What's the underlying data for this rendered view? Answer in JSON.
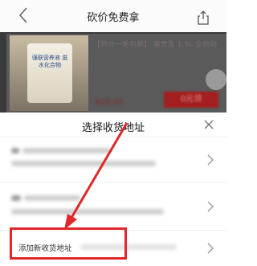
{
  "navbar": {
    "title": "砍价免费拿",
    "back_icon": "chevron-left-icon",
    "share_icon": "share-icon"
  },
  "product": {
    "name": "【特价一毛包邮】 富贵鱼 1.5L 全自动",
    "can_label": "强联营养液 滋水化合物",
    "price": "¥12.00",
    "claim_label": "0元领"
  },
  "sheet": {
    "title": "选择收货地址",
    "close_icon": "close-icon",
    "add_address_label": "添加新收货地址",
    "chevron_icon": "chevron-right-icon"
  },
  "colors": {
    "highlight": "#e0282a",
    "claim_button": "#a31f1f"
  }
}
